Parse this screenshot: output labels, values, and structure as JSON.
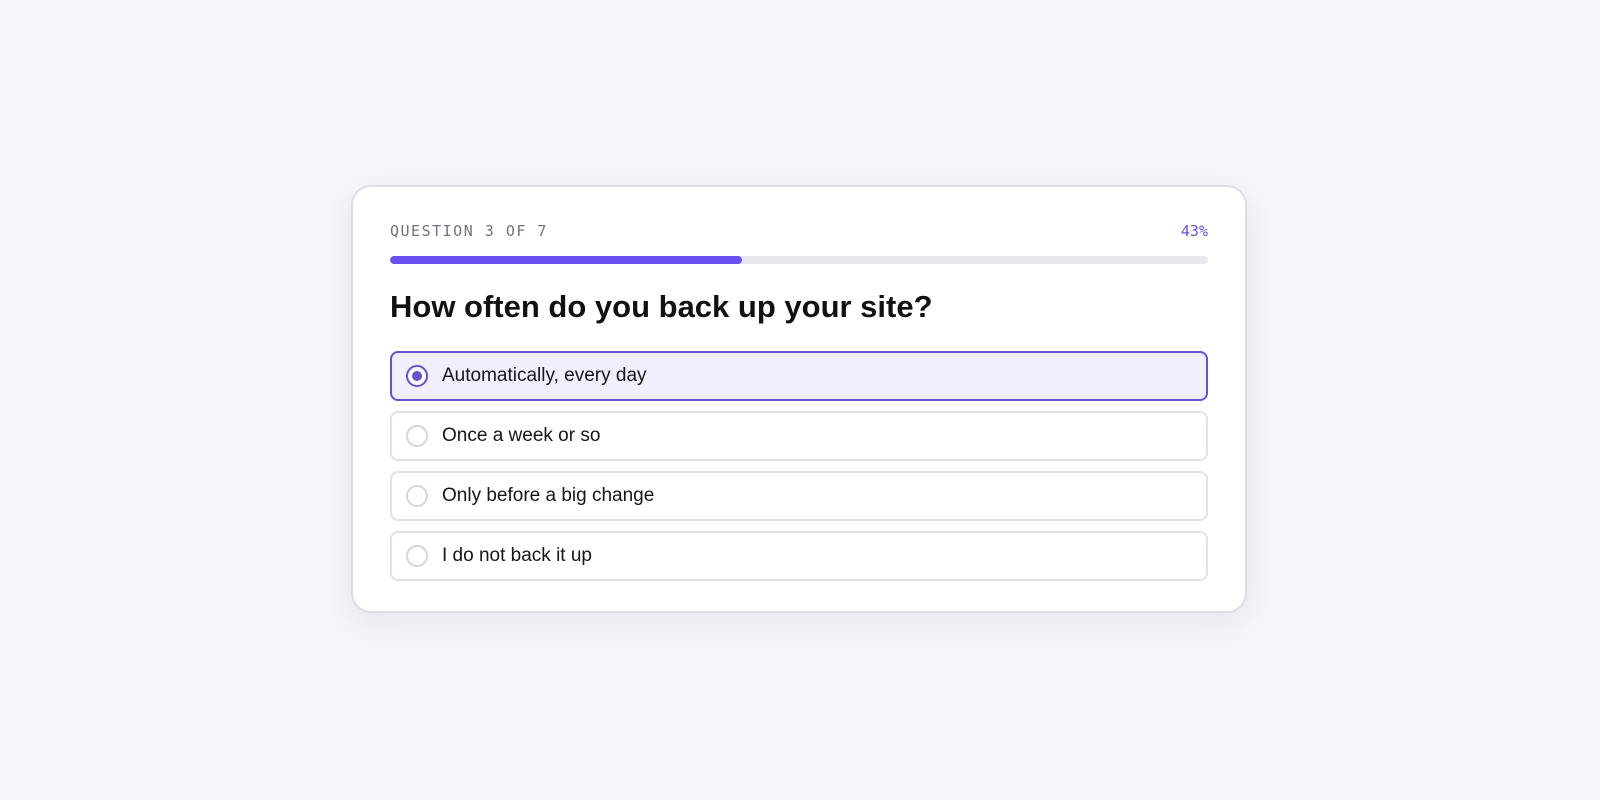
{
  "quiz": {
    "step_label": "QUESTION 3 OF 7",
    "progress_label": "43%",
    "progress_fraction": 0.43,
    "accent_color": "#6a4ff0",
    "question": "How often do you back up your site?",
    "selected_index": 0,
    "options": [
      {
        "label": "Automatically, every day",
        "selected": true
      },
      {
        "label": "Once a week or so",
        "selected": false
      },
      {
        "label": "Only before a big change",
        "selected": false
      },
      {
        "label": "I do not back it up",
        "selected": false
      }
    ]
  }
}
